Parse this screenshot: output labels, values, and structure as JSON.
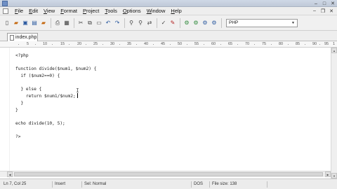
{
  "menu": {
    "items": [
      "File",
      "Edit",
      "View",
      "Format",
      "Project",
      "Tools",
      "Options",
      "Window",
      "Help"
    ]
  },
  "toolbar": {
    "language": "PHP"
  },
  "tab": {
    "filename": "index.php"
  },
  "ruler": {
    "labels": [
      "5",
      "10",
      "15",
      "20",
      "25",
      "30",
      "35",
      "40",
      "45",
      "50",
      "55",
      "60",
      "65",
      "70",
      "75",
      "80",
      "85",
      "90",
      "95"
    ],
    "trailing": "1"
  },
  "editor": {
    "lines": [
      "<?php",
      "",
      "function divide($num1, $num2) {",
      "  if ($num2==0) {",
      "",
      "  } else {",
      "    return $num1/$num2;",
      "  }",
      "}",
      "",
      "echo divide(10, 5);",
      "",
      "?>"
    ],
    "caret_line": 6
  },
  "status": {
    "position": "Ln 7, Col 25",
    "mode": "Insert",
    "selection": "Sel: Normal",
    "line_endings": "DOS",
    "file_size": "File size: 138"
  }
}
